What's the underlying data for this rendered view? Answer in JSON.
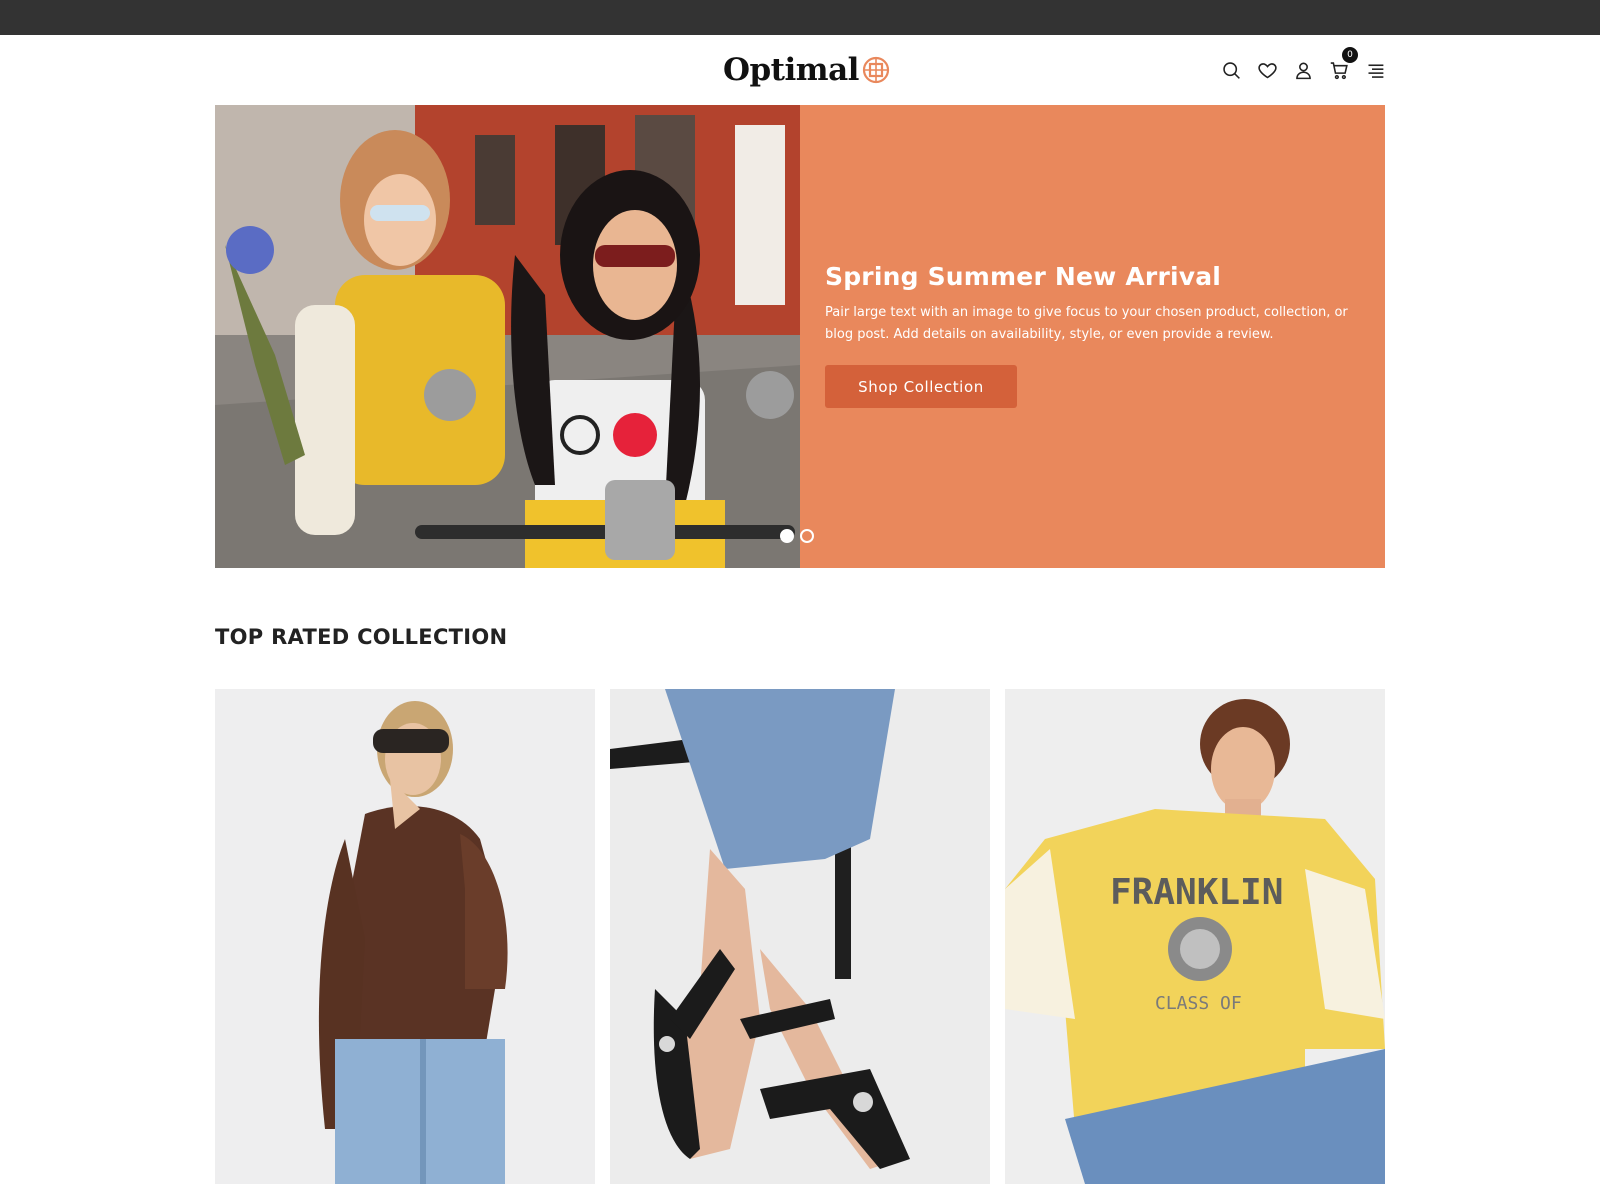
{
  "brand": {
    "name": "Optimal"
  },
  "header": {
    "icons": [
      "search-icon",
      "heart-icon",
      "user-icon",
      "cart-icon",
      "menu-icon"
    ],
    "cart_count": "0"
  },
  "hero": {
    "title": "Spring Summer New Arrival",
    "text": "Pair large text with an image to give focus to your chosen product, collection, or blog post. Add details on availability, style, or even provide a review.",
    "button_label": "Shop Collection",
    "slides": 2,
    "active_slide": 1
  },
  "section": {
    "title": "TOP RATED COLLECTION"
  },
  "colors": {
    "topbar": "#333333",
    "hero_panel": "#e9885c",
    "hero_button": "#d4613a",
    "logo_accent": "#e9885c"
  }
}
